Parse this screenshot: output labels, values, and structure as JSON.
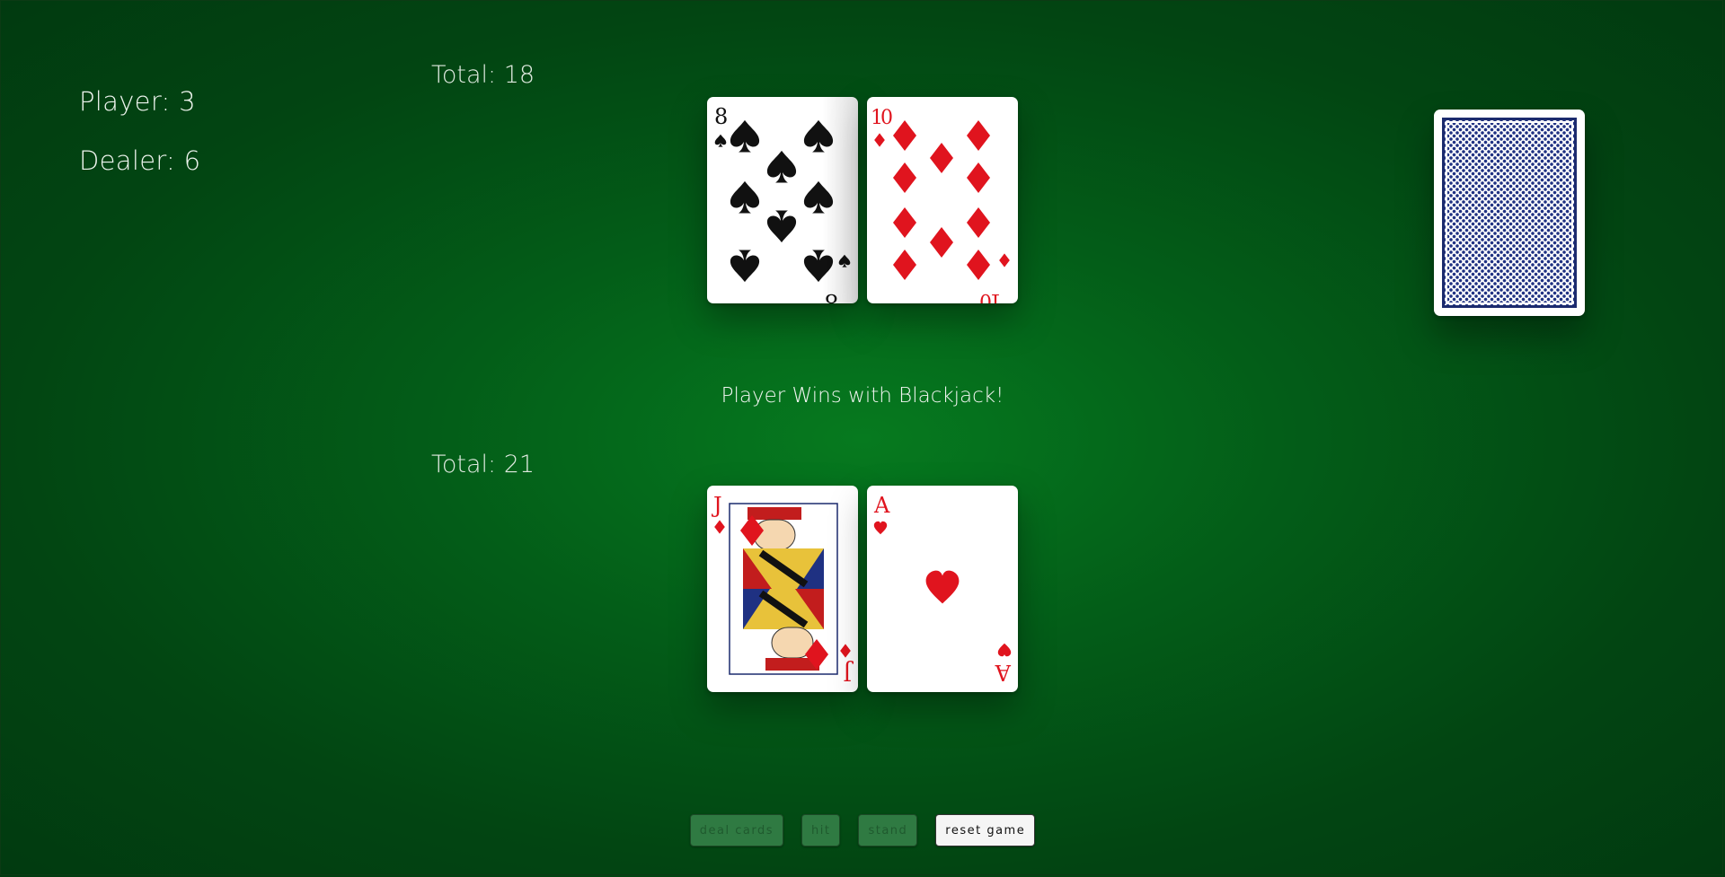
{
  "scoreboard": {
    "player_label": "Player: 3",
    "dealer_label": "Dealer: 6"
  },
  "dealer": {
    "total_label": "Total: 18",
    "cards": [
      {
        "rank": "8",
        "suit": "spades"
      },
      {
        "rank": "10",
        "suit": "diamonds"
      }
    ]
  },
  "player": {
    "total_label": "Total: 21",
    "cards": [
      {
        "rank": "J",
        "suit": "diamonds"
      },
      {
        "rank": "A",
        "suit": "hearts"
      }
    ]
  },
  "message": "Player Wins with Blackjack!",
  "deck": {
    "back_color": "#1f3182"
  },
  "controls": {
    "deal_label": "deal cards",
    "hit_label": "hit",
    "stand_label": "stand",
    "reset_label": "reset game"
  },
  "colors": {
    "felt": "#035d18",
    "red_suit": "#e0141e",
    "black_suit": "#111111"
  }
}
